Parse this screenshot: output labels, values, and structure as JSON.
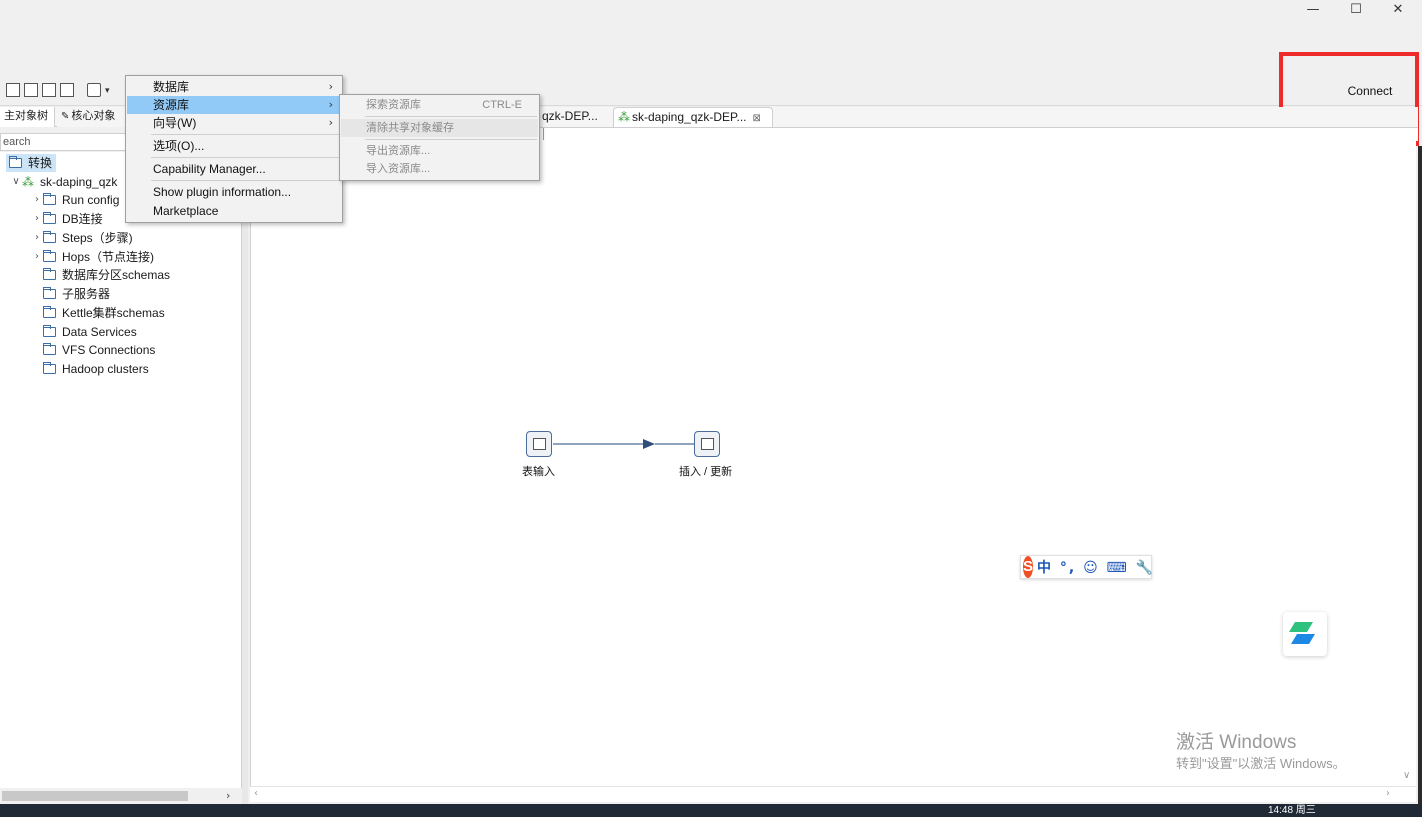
{
  "window": {
    "minimize_icon": "minimize-icon",
    "maximize_icon": "maximize-icon",
    "close_icon": "close-icon",
    "minimize_glyph": "—",
    "maximize_glyph": "☐",
    "close_glyph": "✕"
  },
  "toolbar": {
    "connect_label": "Connect",
    "icons": [
      "new-file-icon",
      "explore-icon",
      "save-icon",
      "save-as-icon",
      "layers-icon",
      "dropdown-caret-icon"
    ],
    "caret_glyph": "▾"
  },
  "highlight_color": "#ef2a2a",
  "left": {
    "tabs": [
      "主对象树",
      "核心对象"
    ],
    "pencil_glyph": "✎",
    "search_placeholder": "earch",
    "tree": {
      "root": "转换",
      "transformation": "sk-daping_qzk",
      "items": [
        {
          "label": "Run config"
        },
        {
          "label": "DB连接"
        },
        {
          "label": "Steps（步骤)"
        },
        {
          "label": "Hops（节点连接)"
        },
        {
          "label": "数据库分区schemas"
        },
        {
          "label": "子服务器"
        },
        {
          "label": "Kettle集群schemas"
        },
        {
          "label": "Data Services"
        },
        {
          "label": "VFS Connections"
        },
        {
          "label": "Hadoop clusters"
        }
      ],
      "expand_glyph": "∨",
      "collapsed_glyph": "›",
      "trans_glyph": "⁂"
    },
    "scroll_right_glyph": "›"
  },
  "editor": {
    "tabs": [
      {
        "label": "qzk-DEP..."
      },
      {
        "label": "sk-daping_qzk-DEP..."
      }
    ],
    "tab_icon_glyph": "⁂",
    "tab_close_glyph": "⊠",
    "steps": [
      {
        "name": "表输入",
        "icon": "table-input-icon"
      },
      {
        "name": "插入 / 更新",
        "icon": "insert-update-icon"
      }
    ],
    "hop_color": "#4a6d9a",
    "scroll_left_glyph": "‹",
    "scroll_right_glyph": "›",
    "scroll_down_glyph": "∨"
  },
  "menu": {
    "items": [
      {
        "label": "数据库",
        "submenu": true
      },
      {
        "label": "资源库",
        "submenu": true,
        "highlighted": true
      },
      {
        "label": "向导(W)",
        "submenu": true
      },
      {
        "label": "选项(O)..."
      },
      {
        "label": "Capability Manager..."
      },
      {
        "label": "Show plugin information..."
      },
      {
        "label": "Marketplace"
      }
    ],
    "arrow_glyph": "›"
  },
  "submenu": {
    "items": [
      {
        "label": "探索资源库",
        "shortcut": "CTRL-E"
      },
      {
        "label": "清除共享对象缓存"
      },
      {
        "label": "导出资源库..."
      },
      {
        "label": "导入资源库..."
      }
    ],
    "disabled": true
  },
  "ime": {
    "logo": "S",
    "text": "中 °, ☺ ⌨ 🔧",
    "logo_color": "#f04e23",
    "text_color": "#1b57b8"
  },
  "floating_logo": "app-logo-icon",
  "watermark": {
    "title": "激活 Windows",
    "subtitle": "转到\"设置\"以激活 Windows。"
  },
  "taskbar": {
    "clock": "14:48 周三"
  }
}
